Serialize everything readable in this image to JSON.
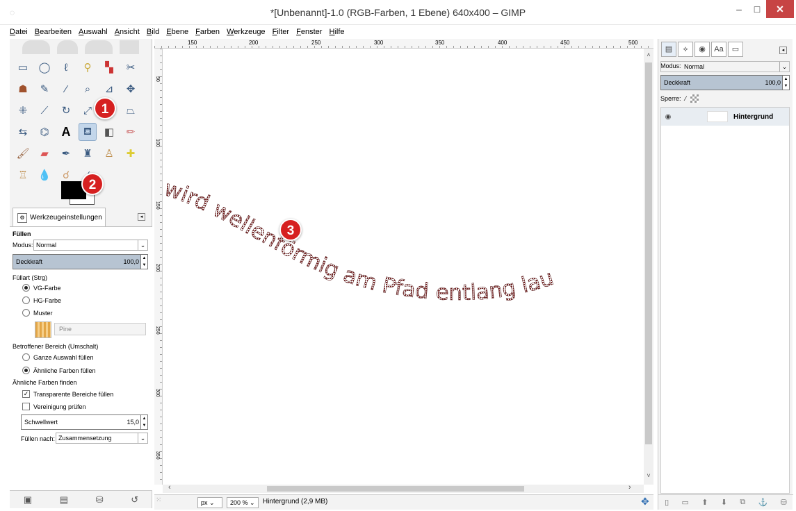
{
  "window": {
    "title": "*[Unbenannt]-1.0 (RGB-Farben, 1 Ebene) 640x400 – GIMP",
    "minimize": "–",
    "maximize": "□",
    "close": "✕"
  },
  "menu": [
    "Datei",
    "Bearbeiten",
    "Auswahl",
    "Ansicht",
    "Bild",
    "Ebene",
    "Farben",
    "Werkzeuge",
    "Filter",
    "Fenster",
    "Hilfe"
  ],
  "toolbox": {
    "tab_label": "Werkzeugeinstellungen",
    "tool_title": "Füllen",
    "modus_label": "Modus:",
    "modus_value": "Normal",
    "opacity_label": "Deckkraft",
    "opacity_value": "100,0",
    "fillart_label": "Füllart  (Strg)",
    "fillart_options": [
      "VG-Farbe",
      "HG-Farbe",
      "Muster"
    ],
    "fillart_selected": 0,
    "pattern_name": "Pine",
    "affected_label": "Betroffener Bereich (Umschalt)",
    "affected_options": [
      "Ganze Auswahl füllen",
      "Ähnliche Farben füllen"
    ],
    "affected_selected": 1,
    "similar_label": "Ähnliche Farben finden",
    "transparent_label": "Transparente Bereiche füllen",
    "transparent_checked": true,
    "merge_label": "Vereinigung prüfen",
    "merge_checked": false,
    "threshold_label": "Schwellwert",
    "threshold_value": "15,0",
    "fill_by_label": "Füllen nach:",
    "fill_by_value": "Zusammensetzung",
    "fg_color": "#000000",
    "bg_color": "#ffffff"
  },
  "badges": [
    "1",
    "2",
    "3"
  ],
  "ruler": {
    "top_labels": [
      "150",
      "200",
      "250",
      "300",
      "350",
      "400",
      "450",
      "500"
    ],
    "left_labels": [
      "50",
      "100",
      "150",
      "200",
      "250",
      "300",
      "350"
    ]
  },
  "canvas": {
    "curved_text": "wird wellenförmig am Pfad entlang lau"
  },
  "status": {
    "unit": "px",
    "zoom": "200 %",
    "info": "Hintergrund (2,9 MB)"
  },
  "layers": {
    "modus_label": "Modus:",
    "modus_value": "Normal",
    "opacity_label": "Deckkraft",
    "opacity_value": "100,0",
    "lock_label": "Sperre:",
    "layer_name": "Hintergrund"
  }
}
